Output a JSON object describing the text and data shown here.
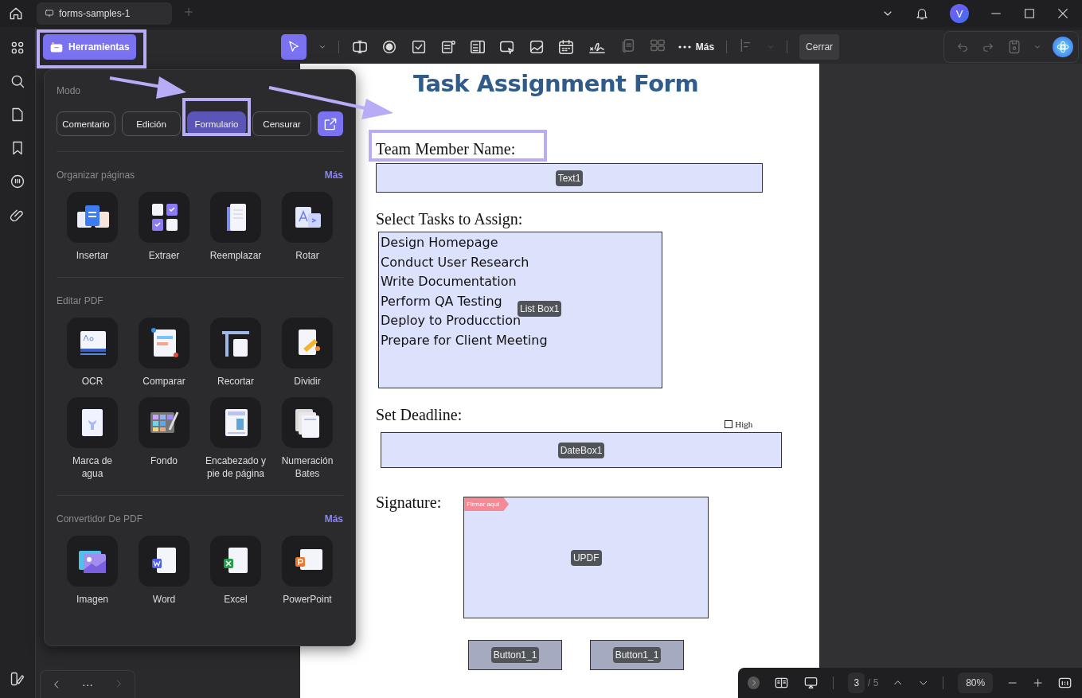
{
  "titlebar": {
    "tab": "forms-samples-1",
    "avatar": "V"
  },
  "toolbar": {
    "tools_button": "Herramientas",
    "more": "Más",
    "close": "Cerrar"
  },
  "tools_panel": {
    "mode_label": "Modo",
    "modes": [
      {
        "label": "Comentario",
        "selected": false
      },
      {
        "label": "Edición",
        "selected": false
      },
      {
        "label": "Formulario",
        "selected": true
      },
      {
        "label": "Censurar",
        "selected": false
      }
    ],
    "sections": [
      {
        "title": "Organizar páginas",
        "more": "Más",
        "items": [
          {
            "label": "Insertar",
            "kind": "insert"
          },
          {
            "label": "Extraer",
            "kind": "extract"
          },
          {
            "label": "Reemplazar",
            "kind": "replace"
          },
          {
            "label": "Rotar",
            "kind": "rotate"
          }
        ]
      },
      {
        "title": "Editar PDF",
        "items": [
          {
            "label": "OCR",
            "kind": "ocr"
          },
          {
            "label": "Comparar",
            "kind": "compare"
          },
          {
            "label": "Recortar",
            "kind": "crop"
          },
          {
            "label": "Dividir",
            "kind": "split"
          },
          {
            "label": "Marca de agua",
            "kind": "watermark"
          },
          {
            "label": "Fondo",
            "kind": "background"
          },
          {
            "label": "Encabezado y pie de página",
            "kind": "header"
          },
          {
            "label": "Numeración Bates",
            "kind": "bates"
          }
        ]
      },
      {
        "title": "Convertidor De PDF",
        "more": "Más",
        "items": [
          {
            "label": "Imagen",
            "kind": "image"
          },
          {
            "label": "Word",
            "kind": "word"
          },
          {
            "label": "Excel",
            "kind": "excel"
          },
          {
            "label": "PowerPoint",
            "kind": "powerpoint"
          }
        ]
      }
    ]
  },
  "form": {
    "title": "Task Assignment Form",
    "name_label": "Team Member Name:",
    "name_field_tag": "Text1",
    "tasks_label": "Select Tasks to Assign:",
    "tasks": [
      "Design Homepage",
      "Conduct User Research",
      "Write Documentation",
      "Perform QA Testing",
      "Deploy to Producction",
      "Prepare for Client Meeting"
    ],
    "tasks_field_tag": "List Box1",
    "deadline_label": "Set Deadline:",
    "priority_checkbox": {
      "label": "High",
      "checked": false
    },
    "deadline_field_tag": "DateBox1",
    "signature_label": "Signature:",
    "signature_hint": "Firmar aquí",
    "signature_field_tag": "UPDF",
    "buttons": [
      {
        "tag": "Button1_1"
      },
      {
        "tag": "Button1_1"
      }
    ]
  },
  "page_nav": {
    "page": "3",
    "total": "/ 5",
    "zoom": "80%"
  },
  "bottom_nav": {
    "more": "···"
  }
}
